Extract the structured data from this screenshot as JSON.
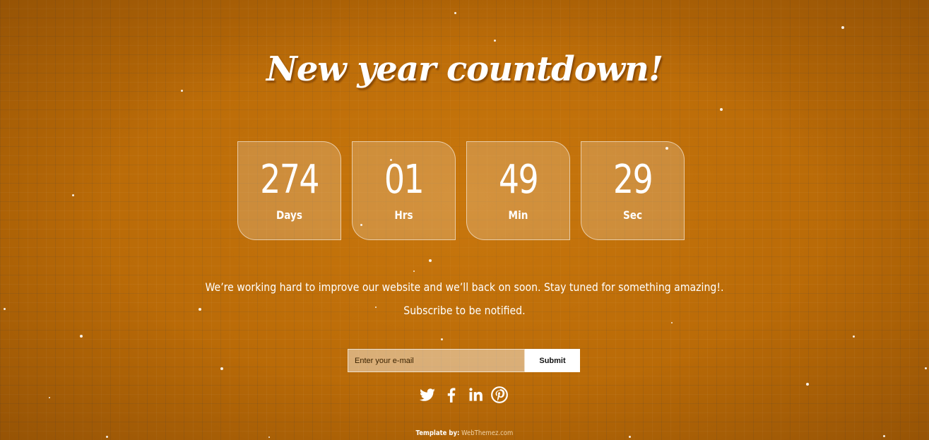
{
  "page": {
    "title": "New year countdown!"
  },
  "countdown": [
    {
      "value": "274",
      "label": "Days"
    },
    {
      "value": "01",
      "label": "Hrs"
    },
    {
      "value": "49",
      "label": "Min"
    },
    {
      "value": "29",
      "label": "Sec"
    }
  ],
  "message": {
    "line1": "We’re working hard to improve our website and we’ll back on soon. Stay tuned for something amazing!.",
    "line2": "Subscribe to be notified."
  },
  "subscribe": {
    "placeholder": "Enter your e-mail",
    "button_label": "Submit"
  },
  "social": {
    "icons": [
      "twitter-icon",
      "facebook-icon",
      "linkedin-icon",
      "pinterest-icon"
    ]
  },
  "footer": {
    "lead": "Template by:",
    "link": "WebThemez.com"
  },
  "colors": {
    "background": "#b96a07",
    "text": "#ffffff",
    "link": "#f1d3a6"
  }
}
